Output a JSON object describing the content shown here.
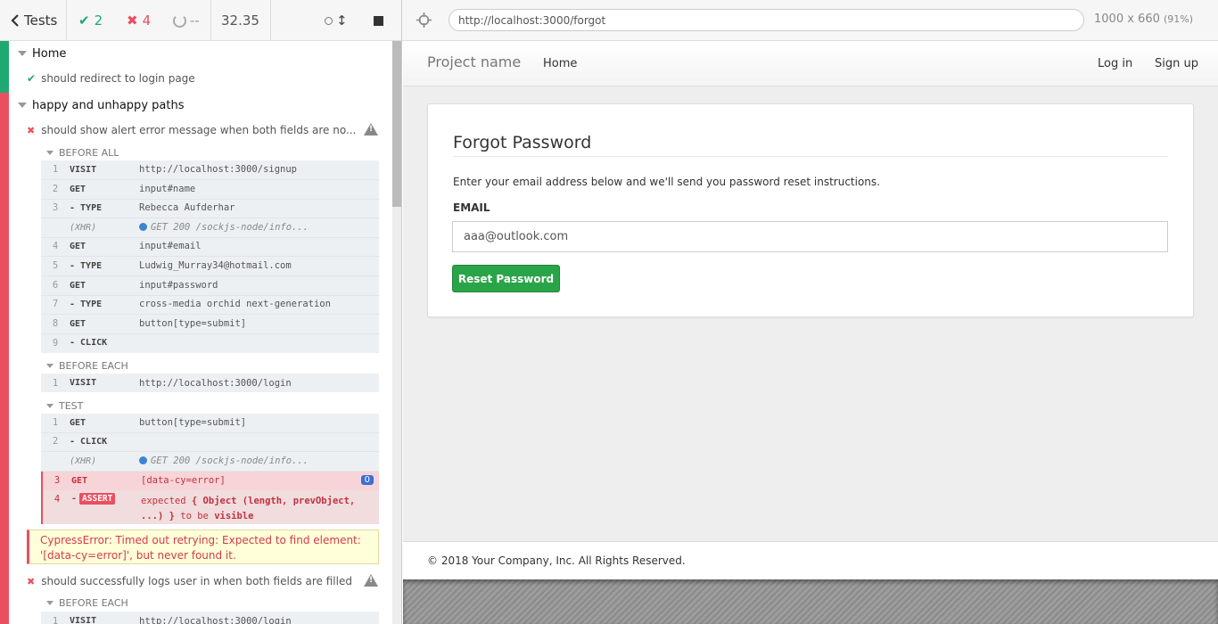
{
  "reporter": {
    "tests_label": "Tests",
    "passed": "2",
    "failed": "4",
    "pending": "--",
    "duration": "32.35",
    "colors": {
      "pass": "#1fa971",
      "fail": "#e94f5f"
    }
  },
  "suites": [
    {
      "title": "Home",
      "tests": [
        {
          "title": "should redirect to login page",
          "state": "passed"
        }
      ]
    },
    {
      "title": "happy and unhappy paths",
      "tests": [
        {
          "title": "should show alert error message when both fields are no...",
          "state": "failed",
          "before_all_label": "BEFORE ALL",
          "before_all": [
            {
              "num": "1",
              "name": "VISIT",
              "msg": "http://localhost:3000/signup"
            },
            {
              "num": "2",
              "name": "GET",
              "msg": "input#name"
            },
            {
              "num": "3",
              "name": "- TYPE",
              "msg": "Rebecca Aufderhar"
            },
            {
              "num": "",
              "name": "(XHR)",
              "msg": "GET 200 /sockjs-node/info..."
            },
            {
              "num": "4",
              "name": "GET",
              "msg": "input#email"
            },
            {
              "num": "5",
              "name": "- TYPE",
              "msg": "Ludwig_Murray34@hotmail.com"
            },
            {
              "num": "6",
              "name": "GET",
              "msg": "input#password"
            },
            {
              "num": "7",
              "name": "- TYPE",
              "msg": "cross-media orchid next-generation"
            },
            {
              "num": "8",
              "name": "GET",
              "msg": "button[type=submit]"
            },
            {
              "num": "9",
              "name": "- CLICK",
              "msg": ""
            }
          ],
          "before_each_label": "BEFORE EACH",
          "before_each": [
            {
              "num": "1",
              "name": "VISIT",
              "msg": "http://localhost:3000/login"
            }
          ],
          "test_label": "TEST",
          "test": [
            {
              "num": "1",
              "name": "GET",
              "msg": "button[type=submit]"
            },
            {
              "num": "2",
              "name": "- CLICK",
              "msg": ""
            },
            {
              "num": "",
              "name": "(XHR)",
              "msg": "GET 200 /sockjs-node/info..."
            },
            {
              "num": "3",
              "name": "GET",
              "msg": "[data-cy=error]",
              "count": "0"
            },
            {
              "num": "4",
              "name": "ASSERT",
              "msg_prefix": "expected",
              "msg_line1": "{ Object (length, prevObject,",
              "msg_line2": "...) }",
              "msg_tobe": "to be",
              "msg_visible": "visible"
            }
          ],
          "error": "CypressError: Timed out retrying: Expected to find element: '[data-cy=error]', but never found it."
        },
        {
          "title": "should successfully logs user in when both fields are filled",
          "state": "failed",
          "before_each_label": "BEFORE EACH",
          "before_each": [
            {
              "num": "1",
              "name": "VISIT",
              "msg": "http://localhost:3000/login"
            }
          ]
        }
      ]
    }
  ],
  "aut": {
    "url": "http://localhost:3000/forgot",
    "viewport": "1000 x 660",
    "scale": "(91%)",
    "navbar": {
      "brand": "Project name",
      "home": "Home",
      "login": "Log in",
      "signup": "Sign up"
    },
    "card": {
      "title": "Forgot Password",
      "text": "Enter your email address below and we'll send you password reset instructions.",
      "label": "EMAIL",
      "email_value": "aaa@outlook.com",
      "button": "Reset Password",
      "button_color": "#2aa448"
    },
    "footer": "© 2018 Your Company, Inc. All Rights Reserved."
  }
}
